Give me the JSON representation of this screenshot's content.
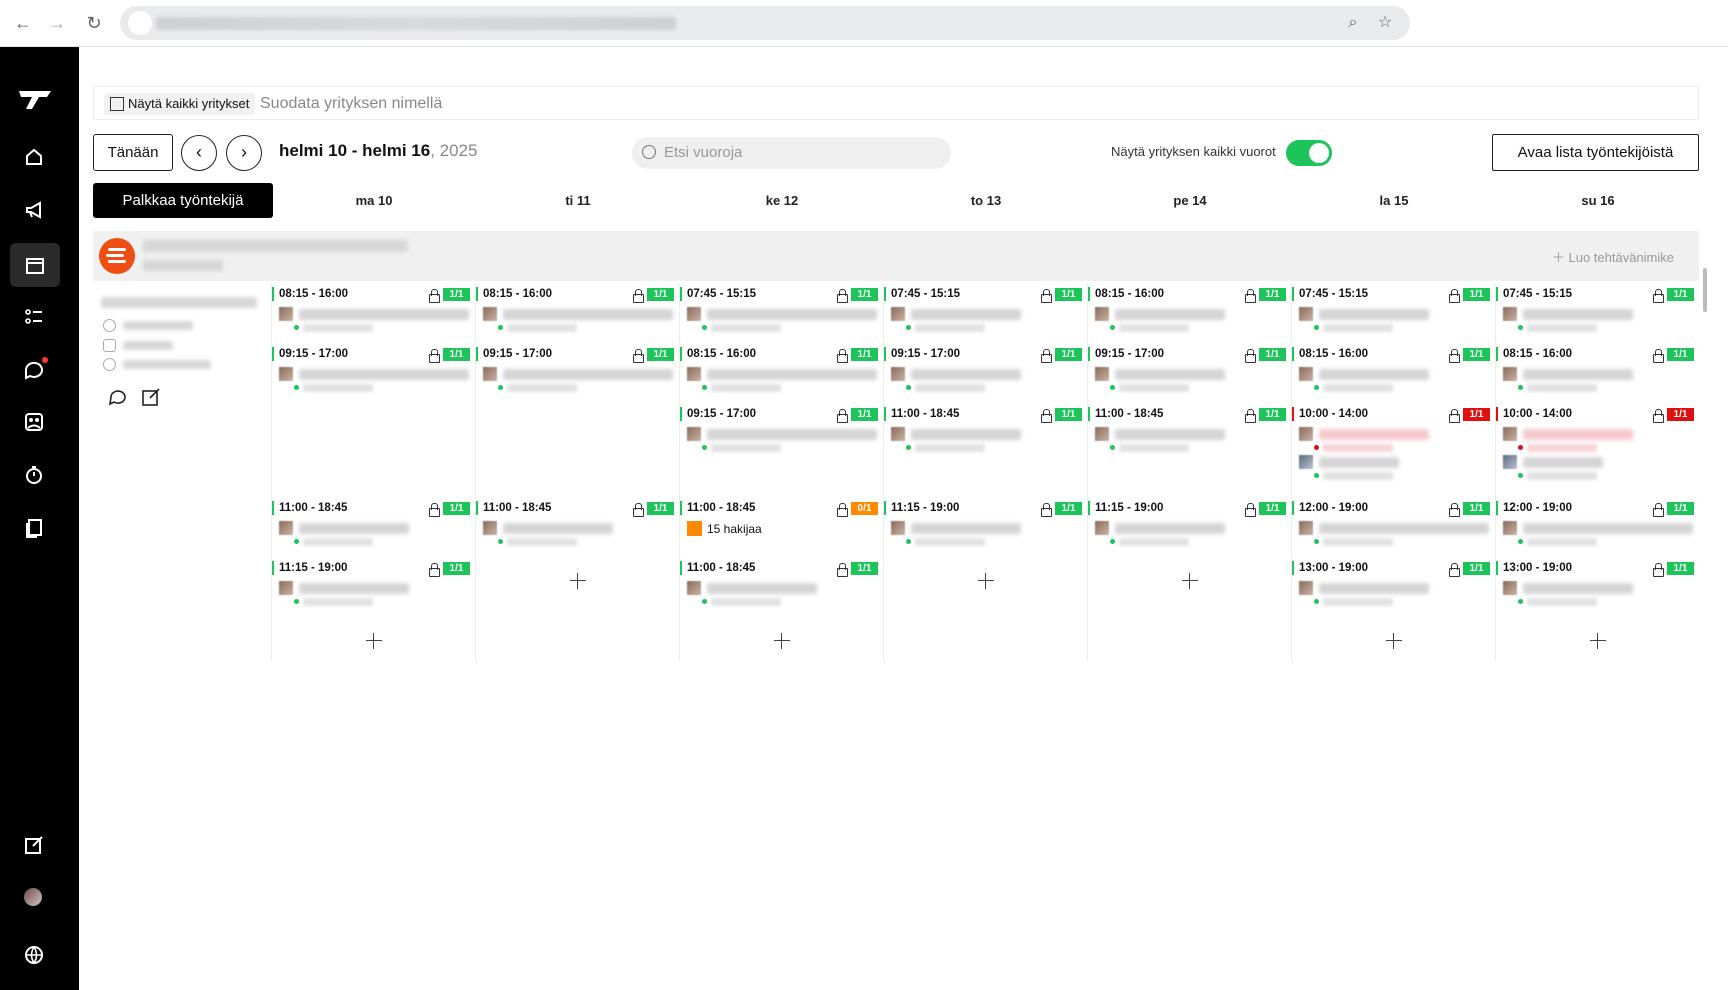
{
  "browser": {
    "back_icon": "arrow-left-icon",
    "forward_icon": "arrow-right-icon",
    "reload_icon": "reload-icon",
    "zoom_icon": "zoom-icon",
    "bookmark_icon": "star-icon"
  },
  "sidebar": {
    "logo": "brand-logo-icon",
    "items": [
      "home-icon",
      "megaphone-icon",
      "calendar-icon",
      "checklist-icon",
      "chat-icon",
      "people-icon",
      "clock-icon",
      "documents-icon"
    ],
    "bottom_items": [
      "edit-icon",
      "avatar",
      "globe-icon"
    ]
  },
  "filter": {
    "show_all_label": "Näytä kaikki yritykset",
    "placeholder": "Suodata yrityksen nimellä"
  },
  "toolbar": {
    "today_label": "Tänään",
    "prev_symbol": "‹",
    "next_symbol": "›",
    "range_label": "helmi 10 - helmi 16",
    "range_year": ", 2025",
    "search_placeholder": "Etsi vuoroja",
    "toggle_label": "Näytä yrityksen kaikki vuorot",
    "toggle_on": true,
    "open_list_label": "Avaa lista työntekijöistä",
    "hire_label": "Palkkaa työntekijä"
  },
  "days": [
    "ma 10",
    "ti 11",
    "ke 12",
    "to 13",
    "pe 14",
    "la 15",
    "su 16"
  ],
  "group": {
    "add_task_label": "Luo tehtävänimike",
    "accent_color": "#ee4d14"
  },
  "colors": {
    "green": "#1dc45a",
    "red": "#e01010",
    "orange": "#ff8a00"
  },
  "applicants_label": "15 hakijaa",
  "rows": [
    [
      "08:15 - 16:00",
      "08:15 - 16:00",
      "07:45 - 15:15",
      "07:45 - 15:15",
      "08:15 - 16:00",
      "07:45 - 15:15",
      "07:45 - 15:15"
    ],
    [
      "09:15 - 17:00",
      "09:15 - 17:00",
      "08:15 - 16:00",
      "09:15 - 17:00",
      "09:15 - 17:00",
      "08:15 - 16:00",
      "08:15 - 16:00"
    ],
    [
      "",
      "",
      "09:15 - 17:00",
      "11:00 - 18:45",
      "11:00 - 18:45",
      "10:00 - 14:00",
      "10:00 - 14:00"
    ],
    [
      "11:00 - 18:45",
      "11:00 - 18:45",
      "11:00 - 18:45",
      "11:15 - 19:00",
      "11:15 - 19:00",
      "12:00 - 19:00",
      "12:00 - 19:00"
    ],
    [
      "11:15 - 19:00",
      "",
      "11:00 - 18:45",
      "",
      "",
      "13:00 - 19:00",
      "13:00 - 19:00"
    ]
  ],
  "badges": [
    [
      "1/1",
      "1/1",
      "1/1",
      "1/1",
      "1/1",
      "1/1",
      "1/1"
    ],
    [
      "1/1",
      "1/1",
      "1/1",
      "1/1",
      "1/1",
      "1/1",
      "1/1"
    ],
    [
      "",
      "",
      "1/1",
      "1/1",
      "1/1",
      "1/1",
      "1/1"
    ],
    [
      "1/1",
      "1/1",
      "0/1",
      "1/1",
      "1/1",
      "1/1",
      "1/1"
    ],
    [
      "1/1",
      "",
      "1/1",
      "",
      "",
      "1/1",
      "1/1"
    ]
  ]
}
